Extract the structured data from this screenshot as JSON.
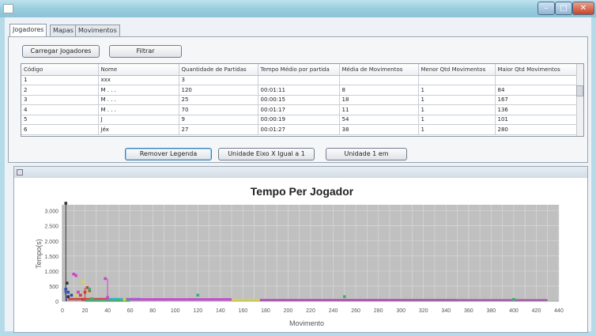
{
  "window": {
    "title": "",
    "min_glyph": "–",
    "max_glyph": "□",
    "close_glyph": "✕"
  },
  "tabs": [
    {
      "label": "Jogadores",
      "active": true
    },
    {
      "label": "Mapas",
      "active": false
    },
    {
      "label": "Movimentos",
      "active": false
    }
  ],
  "toolbar": {
    "load_label": "Carregar Jogadores",
    "filter_label": "Filtrar"
  },
  "table": {
    "columns": [
      "Código",
      "Nome",
      "Quantidade de Partidas",
      "Tempo Médio por partida",
      "Média de Movimentos",
      "Menor Qtd Movimentos",
      "Maior Qtd Movimentos"
    ],
    "rows": [
      [
        "1",
        "xxx",
        "3",
        "",
        "",
        "",
        ""
      ],
      [
        "2",
        "M . . .",
        "120",
        "00:01:11",
        "8",
        "1",
        "84"
      ],
      [
        "3",
        "M . . .",
        "25",
        "00:00:15",
        "18",
        "1",
        "167"
      ],
      [
        "4",
        "M . . .",
        "70",
        "00:01:17",
        "11",
        "1",
        "136"
      ],
      [
        "5",
        "J",
        "9",
        "00:00:19",
        "54",
        "1",
        "101"
      ],
      [
        "6",
        "Jéx",
        "27",
        "00:01:27",
        "38",
        "1",
        "280"
      ]
    ]
  },
  "actions": {
    "legend_label": "Remover Legenda",
    "zoom1_label": "Unidade Eixo X Igual a 1",
    "zoom2_label": "Unidade 1 em"
  },
  "chart_data": {
    "type": "scatter",
    "title": "Tempo Per Jogador",
    "xlabel": "Movimento",
    "ylabel": "Tempo(s)",
    "xlim": [
      0,
      440
    ],
    "ylim": [
      0,
      3200
    ],
    "x_ticks": [
      "0",
      "10",
      "20",
      "30",
      "40",
      "50",
      "60",
      "70",
      "80",
      "90",
      "100",
      "110",
      "120",
      "130",
      "140",
      "150",
      "160",
      "170",
      "180",
      "190",
      "200",
      "210",
      "220",
      "230",
      "240",
      "250",
      "260",
      "270",
      "280",
      "290",
      "300",
      "310",
      "320",
      "330",
      "340",
      "350",
      "360",
      "370",
      "380",
      "390",
      "400",
      "410",
      "420",
      "430",
      "440"
    ],
    "x_tick_labels": [
      "0",
      "20",
      "40",
      "60",
      "80",
      "100",
      "120",
      "140",
      "160",
      "180",
      "200",
      "220",
      "240",
      "260",
      "280",
      "300",
      "320",
      "340",
      "360",
      "380",
      "400",
      "420",
      "440"
    ],
    "y_ticks": [
      0,
      500,
      1000,
      1500,
      2000,
      2500,
      3000
    ],
    "y_tick_labels": [
      "0",
      "500",
      "1.000",
      "1.500",
      "2.000",
      "2.500",
      "3.000"
    ],
    "grid": true,
    "plot_bg": "#c0c0c0",
    "grid_color": "#dcdcdc",
    "series": [
      {
        "color": "#333333",
        "points": [
          [
            3,
            3250
          ],
          [
            4,
            600
          ],
          [
            5,
            150
          ]
        ],
        "segments": [
          [
            3,
            3250,
            3,
            0
          ]
        ]
      },
      {
        "color": "#2f4fb0",
        "points": [
          [
            3,
            400
          ],
          [
            5,
            300
          ],
          [
            8,
            200
          ]
        ],
        "segments": [
          [
            2,
            350,
            4,
            0
          ]
        ]
      },
      {
        "color": "#d9d24a",
        "points": [
          [
            12,
            200
          ],
          [
            18,
            650
          ],
          [
            22,
            300
          ],
          [
            55,
            60
          ]
        ],
        "segments": []
      },
      {
        "color": "#d040d0",
        "points": [
          [
            10,
            900
          ],
          [
            12,
            850
          ],
          [
            14,
            300
          ],
          [
            38,
            750
          ],
          [
            40,
            120
          ]
        ],
        "segments": [
          [
            40,
            750,
            40,
            0
          ]
        ]
      },
      {
        "color": "#c84040",
        "points": [
          [
            16,
            200
          ],
          [
            18,
            60
          ],
          [
            20,
            300
          ],
          [
            22,
            450
          ],
          [
            24,
            350
          ]
        ],
        "segments": [
          [
            20,
            450,
            20,
            0
          ]
        ]
      },
      {
        "color": "#3ab070",
        "points": [
          [
            24,
            400
          ],
          [
            26,
            80
          ],
          [
            120,
            200
          ],
          [
            250,
            150
          ],
          [
            400,
            60
          ]
        ],
        "segments": []
      }
    ],
    "bands": [
      {
        "color": "#d04a4a",
        "x0": 5,
        "x1": 40,
        "y": 70
      },
      {
        "color": "#38b8c8",
        "x0": 40,
        "x1": 70,
        "y": 70
      },
      {
        "color": "#c64ad2",
        "x0": 55,
        "x1": 150,
        "y": 60
      },
      {
        "color": "#d9d24a",
        "x0": 150,
        "x1": 175,
        "y": 40
      },
      {
        "color": "#b44ab8",
        "x0": 175,
        "x1": 350,
        "y": 35
      },
      {
        "color": "#a55aa8",
        "x0": 300,
        "x1": 430,
        "y": 30
      },
      {
        "color": "#3ab070",
        "x0": 20,
        "x1": 60,
        "y": 20
      }
    ]
  }
}
